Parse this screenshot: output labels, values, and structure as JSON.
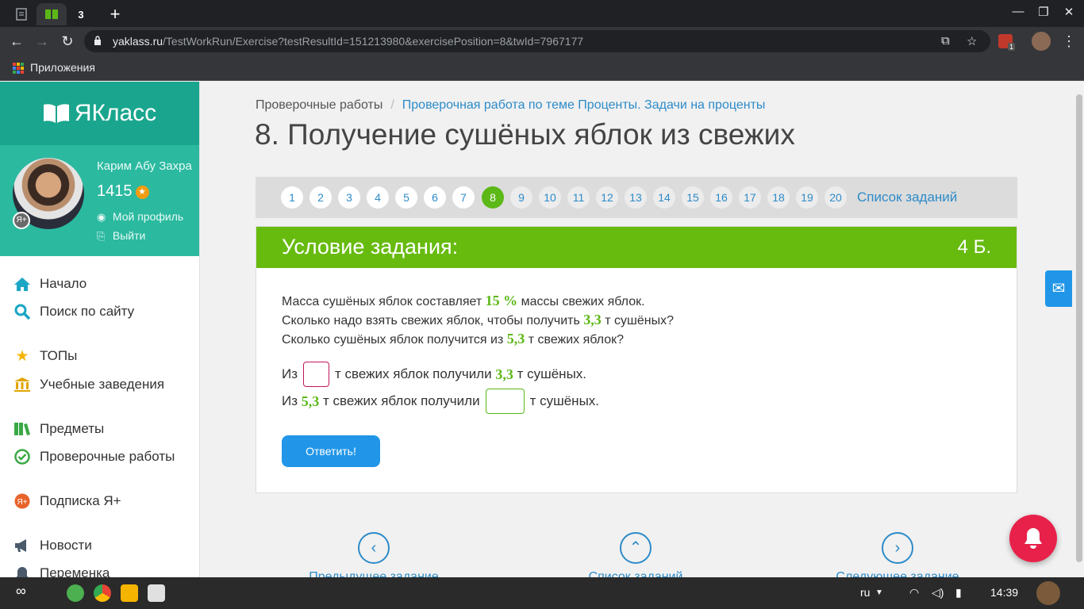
{
  "browser": {
    "tab_label": "3",
    "url_host": "yaklass.ru",
    "url_path": "/TestWorkRun/Exercise?testResultId=151213980&exercisePosition=8&twId=7967177",
    "bookmark_apps": "Приложения",
    "ext_badge": "1"
  },
  "sidebar": {
    "logo": "ЯКласс",
    "user_name": "Карим Абу Захра",
    "points": "1415",
    "my_profile": "Мой профиль",
    "logout": "Выйти",
    "menu": [
      {
        "label": "Начало",
        "icon": "home-icon"
      },
      {
        "label": "Поиск по сайту",
        "icon": "search-icon"
      },
      {
        "label": "ТОПы",
        "icon": "star-icon"
      },
      {
        "label": "Учебные заведения",
        "icon": "institution-icon"
      },
      {
        "label": "Предметы",
        "icon": "books-icon"
      },
      {
        "label": "Проверочные работы",
        "icon": "check-circle-icon"
      },
      {
        "label": "Подписка Я+",
        "icon": "yplus-icon"
      },
      {
        "label": "Новости",
        "icon": "megaphone-icon"
      },
      {
        "label": "Переменка",
        "icon": "bell-icon"
      }
    ]
  },
  "breadcrumb": {
    "root": "Проверочные работы",
    "separator": "/",
    "current": "Проверочная работа по теме Проценты. Задачи на проценты"
  },
  "page_title": "8. Получение сушёных яблок из свежих",
  "pager": {
    "pages": [
      "1",
      "2",
      "3",
      "4",
      "5",
      "6",
      "7",
      "8",
      "9",
      "10",
      "11",
      "12",
      "13",
      "14",
      "15",
      "16",
      "17",
      "18",
      "19",
      "20"
    ],
    "current": "8",
    "task_list": "Список заданий"
  },
  "condition": {
    "title": "Условие задания:",
    "points": "4 Б.",
    "line1_a": "Масса сушёных яблок составляет",
    "line1_num": "15 %",
    "line1_b": "массы свежих яблок.",
    "line2_a": "Сколько надо взять свежих яблок, чтобы получить",
    "line2_num": "3,3",
    "line2_b": "т сушёных?",
    "line3_a": "Сколько сушёных яблок получится из",
    "line3_num": "5,3",
    "line3_b": "т свежих яблок?",
    "ans1_a": "Из",
    "ans1_b": "т свежих яблок получили",
    "ans1_num": "3,3",
    "ans1_c": "т сушёных.",
    "ans2_a": "Из",
    "ans2_num": "5,3",
    "ans2_b": "т свежих яблок получили",
    "ans2_c": "т сушёных.",
    "input1_value": "",
    "input2_value": "",
    "submit": "Ответить!"
  },
  "bottom_nav": {
    "prev": "Предыдущее задание",
    "list": "Список заданий",
    "next": "Следующее задание"
  },
  "taskbar": {
    "lang": "ru",
    "time": "14:39"
  },
  "colors": {
    "accent_green": "#67bb0f",
    "brand_teal": "#1aa68e",
    "link_blue": "#2d8bc9",
    "button_blue": "#2196e8"
  }
}
